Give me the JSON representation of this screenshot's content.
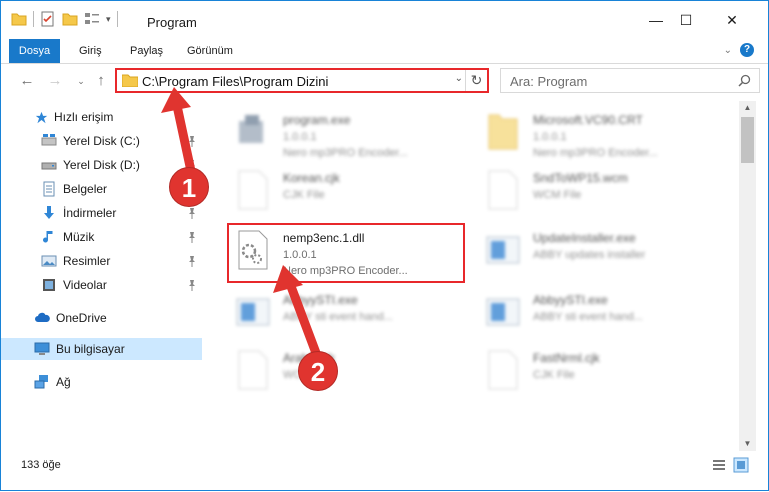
{
  "window": {
    "title": "Program",
    "controls": {
      "minimize": "—",
      "maximize": "☐",
      "close": "✕"
    }
  },
  "ribbon": {
    "tabs": [
      "Dosya",
      "Giriş",
      "Paylaş",
      "Görünüm"
    ],
    "help": "?"
  },
  "address": {
    "path": "C:\\Program Files\\Program Dizini",
    "search_placeholder": "Ara: Program"
  },
  "sidebar": {
    "items": [
      {
        "label": "Hızlı erişim",
        "icon": "star-icon",
        "pinned": false
      },
      {
        "label": "Yerel Disk (C:)",
        "icon": "drive-icon",
        "pinned": true
      },
      {
        "label": "Yerel Disk (D:)",
        "icon": "drive-icon",
        "pinned": true
      },
      {
        "label": "Belgeler",
        "icon": "documents-icon",
        "pinned": true
      },
      {
        "label": "İndirmeler",
        "icon": "download-icon",
        "pinned": true
      },
      {
        "label": "Müzik",
        "icon": "music-icon",
        "pinned": true
      },
      {
        "label": "Resimler",
        "icon": "pictures-icon",
        "pinned": true
      },
      {
        "label": "Videolar",
        "icon": "videos-icon",
        "pinned": true
      },
      {
        "label": "OneDrive",
        "icon": "cloud-icon",
        "pinned": false
      },
      {
        "label": "Bu bilgisayar",
        "icon": "computer-icon",
        "pinned": false,
        "selected": true
      },
      {
        "label": "Ağ",
        "icon": "network-icon",
        "pinned": false
      }
    ]
  },
  "files": [
    {
      "name": "program.exe",
      "version": "1.0.0.1",
      "description": "Nero mp3PRO Encoder...",
      "type": "exe",
      "blurred": true
    },
    {
      "name": "Microsoft.VC90.CRT",
      "version": "1.0.0.1",
      "description": "Nero mp3PRO Encoder...",
      "type": "folder",
      "blurred": true
    },
    {
      "name": "Korean.cjk",
      "version": "CJK File",
      "description": "",
      "type": "blank",
      "blurred": true
    },
    {
      "name": "SndToWP15.wcm",
      "version": "WCM File",
      "description": "",
      "type": "blank",
      "blurred": true
    },
    {
      "name": "nemp3enc.1.dll",
      "version": "1.0.0.1",
      "description": "Nero mp3PRO Encoder...",
      "type": "dll",
      "blurred": false
    },
    {
      "name": "UpdateInstaller.exe",
      "version": "ABBY updates installer",
      "description": "",
      "type": "app",
      "blurred": true
    },
    {
      "name": "AbbyySTI.exe",
      "version": "ABBY sti event hand...",
      "description": "",
      "type": "app",
      "blurred": true
    },
    {
      "name": "AbbyySTI.exe",
      "version": "ABBY sti event hand...",
      "description": "",
      "type": "app",
      "blurred": true
    },
    {
      "name": "Arabic.cjk",
      "version": "WCM File",
      "description": "",
      "type": "blank",
      "blurred": true
    },
    {
      "name": "FastNrml.cjk",
      "version": "CJK File",
      "description": "",
      "type": "blank",
      "blurred": true
    }
  ],
  "status": {
    "item_count": "133 öğe"
  },
  "annotations": {
    "step1": "1",
    "step2": "2",
    "arrow_color": "#e0342f"
  }
}
